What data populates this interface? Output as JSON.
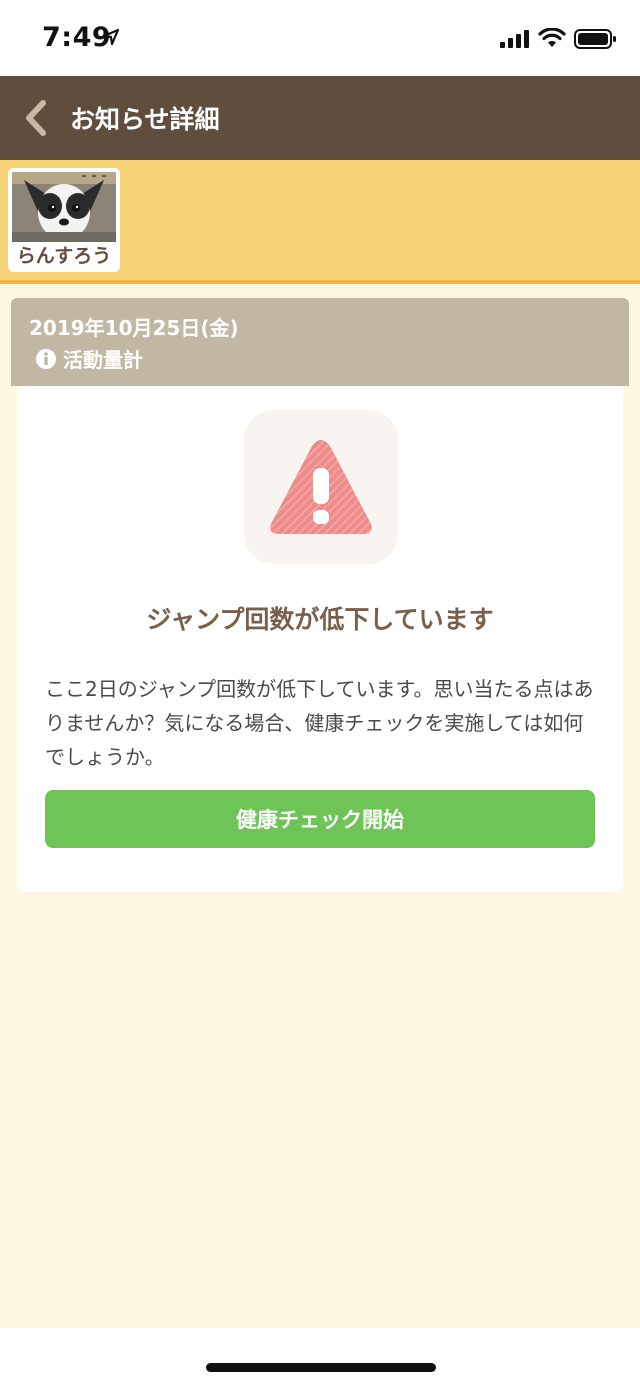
{
  "status_bar": {
    "time": "7:49"
  },
  "nav": {
    "title": "お知らせ詳細"
  },
  "pet": {
    "name": "らんすろう"
  },
  "notification": {
    "date": "2019年10月25日(金)",
    "category": "活動量計",
    "title": "ジャンプ回数が低下しています",
    "body": "ここ2日のジャンプ回数が低下しています。思い当たる点はありませんか？気になる場合、健康チェックを実施しては如何でしょうか。",
    "button_label": "健康チェック開始"
  },
  "colors": {
    "nav_background": "#5f4d3d",
    "pet_bar_background": "#f6d377",
    "date_header_background": "#c2b7a3",
    "button_green": "#6ec457",
    "warning_red": "#ee8a8a",
    "page_background": "#fdf6e0"
  },
  "icons": {
    "back": "chevron-left-icon",
    "info": "info-icon",
    "warning": "warning-triangle-icon"
  }
}
